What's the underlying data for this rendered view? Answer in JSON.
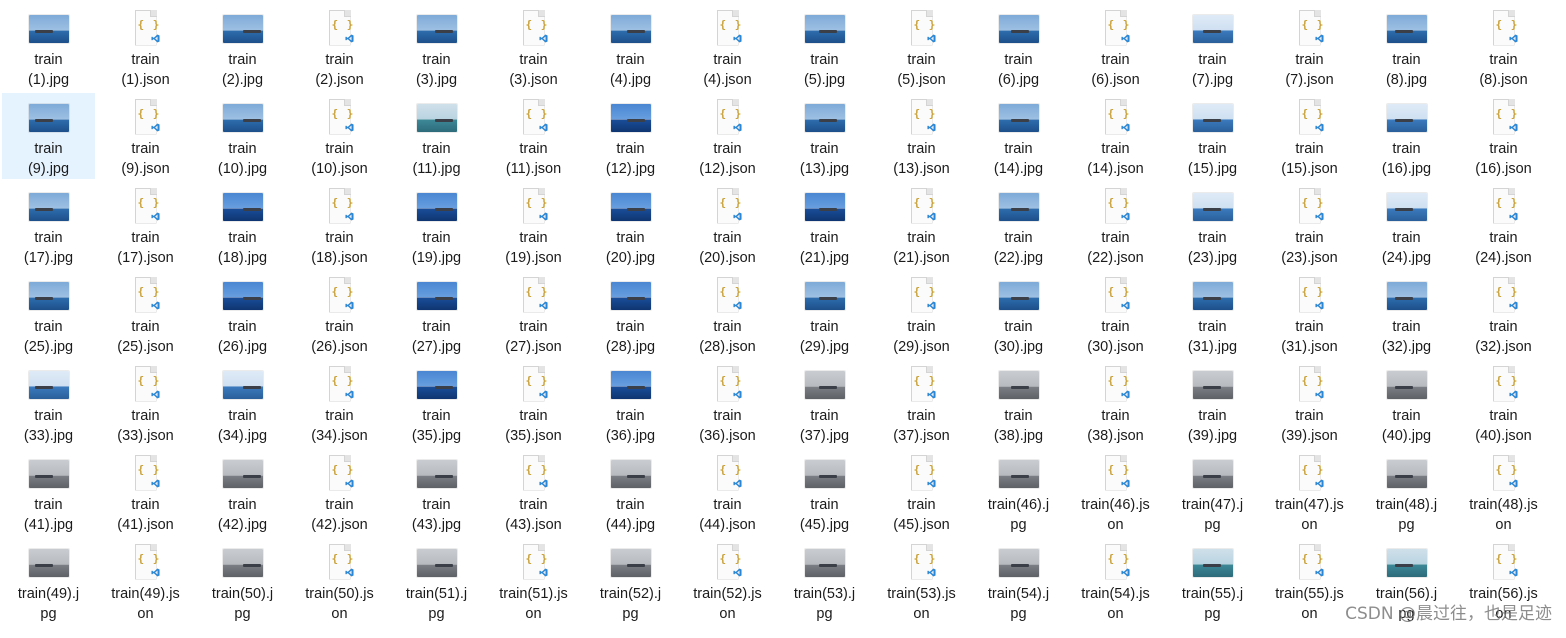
{
  "files": [
    {
      "label": "train\n(1).jpg",
      "kind": "jpg",
      "thumb": "blue"
    },
    {
      "label": "train\n(1).json",
      "kind": "json"
    },
    {
      "label": "train\n(2).jpg",
      "kind": "jpg",
      "thumb": "blue"
    },
    {
      "label": "train\n(2).json",
      "kind": "json"
    },
    {
      "label": "train\n(3).jpg",
      "kind": "jpg",
      "thumb": "blue"
    },
    {
      "label": "train\n(3).json",
      "kind": "json"
    },
    {
      "label": "train\n(4).jpg",
      "kind": "jpg",
      "thumb": "blue"
    },
    {
      "label": "train\n(4).json",
      "kind": "json"
    },
    {
      "label": "train\n(5).jpg",
      "kind": "jpg",
      "thumb": "blue"
    },
    {
      "label": "train\n(5).json",
      "kind": "json"
    },
    {
      "label": "train\n(6).jpg",
      "kind": "jpg",
      "thumb": "blue"
    },
    {
      "label": "train\n(6).json",
      "kind": "json"
    },
    {
      "label": "train\n(7).jpg",
      "kind": "jpg",
      "thumb": "cloud"
    },
    {
      "label": "train\n(7).json",
      "kind": "json"
    },
    {
      "label": "train\n(8).jpg",
      "kind": "jpg",
      "thumb": "blue"
    },
    {
      "label": "train\n(8).json",
      "kind": "json"
    },
    {
      "label": "train\n(9).jpg",
      "kind": "jpg",
      "thumb": "blue",
      "selected": true
    },
    {
      "label": "train\n(9).json",
      "kind": "json"
    },
    {
      "label": "train\n(10).jpg",
      "kind": "jpg",
      "thumb": "blue"
    },
    {
      "label": "train\n(10).json",
      "kind": "json"
    },
    {
      "label": "train\n(11).jpg",
      "kind": "jpg",
      "thumb": "teal"
    },
    {
      "label": "train\n(11).json",
      "kind": "json"
    },
    {
      "label": "train\n(12).jpg",
      "kind": "jpg",
      "thumb": "deep"
    },
    {
      "label": "train\n(12).json",
      "kind": "json"
    },
    {
      "label": "train\n(13).jpg",
      "kind": "jpg",
      "thumb": "blue"
    },
    {
      "label": "train\n(13).json",
      "kind": "json"
    },
    {
      "label": "train\n(14).jpg",
      "kind": "jpg",
      "thumb": "blue"
    },
    {
      "label": "train\n(14).json",
      "kind": "json"
    },
    {
      "label": "train\n(15).jpg",
      "kind": "jpg",
      "thumb": "cloud"
    },
    {
      "label": "train\n(15).json",
      "kind": "json"
    },
    {
      "label": "train\n(16).jpg",
      "kind": "jpg",
      "thumb": "cloud"
    },
    {
      "label": "train\n(16).json",
      "kind": "json"
    },
    {
      "label": "train\n(17).jpg",
      "kind": "jpg",
      "thumb": "blue"
    },
    {
      "label": "train\n(17).json",
      "kind": "json"
    },
    {
      "label": "train\n(18).jpg",
      "kind": "jpg",
      "thumb": "deep"
    },
    {
      "label": "train\n(18).json",
      "kind": "json"
    },
    {
      "label": "train\n(19).jpg",
      "kind": "jpg",
      "thumb": "deep"
    },
    {
      "label": "train\n(19).json",
      "kind": "json"
    },
    {
      "label": "train\n(20).jpg",
      "kind": "jpg",
      "thumb": "deep"
    },
    {
      "label": "train\n(20).json",
      "kind": "json"
    },
    {
      "label": "train\n(21).jpg",
      "kind": "jpg",
      "thumb": "deep"
    },
    {
      "label": "train\n(21).json",
      "kind": "json"
    },
    {
      "label": "train\n(22).jpg",
      "kind": "jpg",
      "thumb": "blue"
    },
    {
      "label": "train\n(22).json",
      "kind": "json"
    },
    {
      "label": "train\n(23).jpg",
      "kind": "jpg",
      "thumb": "cloud"
    },
    {
      "label": "train\n(23).json",
      "kind": "json"
    },
    {
      "label": "train\n(24).jpg",
      "kind": "jpg",
      "thumb": "cloud"
    },
    {
      "label": "train\n(24).json",
      "kind": "json"
    },
    {
      "label": "train\n(25).jpg",
      "kind": "jpg",
      "thumb": "blue"
    },
    {
      "label": "train\n(25).json",
      "kind": "json"
    },
    {
      "label": "train\n(26).jpg",
      "kind": "jpg",
      "thumb": "deep"
    },
    {
      "label": "train\n(26).json",
      "kind": "json"
    },
    {
      "label": "train\n(27).jpg",
      "kind": "jpg",
      "thumb": "deep"
    },
    {
      "label": "train\n(27).json",
      "kind": "json"
    },
    {
      "label": "train\n(28).jpg",
      "kind": "jpg",
      "thumb": "deep"
    },
    {
      "label": "train\n(28).json",
      "kind": "json"
    },
    {
      "label": "train\n(29).jpg",
      "kind": "jpg",
      "thumb": "blue"
    },
    {
      "label": "train\n(29).json",
      "kind": "json"
    },
    {
      "label": "train\n(30).jpg",
      "kind": "jpg",
      "thumb": "blue"
    },
    {
      "label": "train\n(30).json",
      "kind": "json"
    },
    {
      "label": "train\n(31).jpg",
      "kind": "jpg",
      "thumb": "blue"
    },
    {
      "label": "train\n(31).json",
      "kind": "json"
    },
    {
      "label": "train\n(32).jpg",
      "kind": "jpg",
      "thumb": "blue"
    },
    {
      "label": "train\n(32).json",
      "kind": "json"
    },
    {
      "label": "train\n(33).jpg",
      "kind": "jpg",
      "thumb": "cloud"
    },
    {
      "label": "train\n(33).json",
      "kind": "json"
    },
    {
      "label": "train\n(34).jpg",
      "kind": "jpg",
      "thumb": "cloud"
    },
    {
      "label": "train\n(34).json",
      "kind": "json"
    },
    {
      "label": "train\n(35).jpg",
      "kind": "jpg",
      "thumb": "deep"
    },
    {
      "label": "train\n(35).json",
      "kind": "json"
    },
    {
      "label": "train\n(36).jpg",
      "kind": "jpg",
      "thumb": "deep"
    },
    {
      "label": "train\n(36).json",
      "kind": "json"
    },
    {
      "label": "train\n(37).jpg",
      "kind": "jpg",
      "thumb": "grey"
    },
    {
      "label": "train\n(37).json",
      "kind": "json"
    },
    {
      "label": "train\n(38).jpg",
      "kind": "jpg",
      "thumb": "grey"
    },
    {
      "label": "train\n(38).json",
      "kind": "json"
    },
    {
      "label": "train\n(39).jpg",
      "kind": "jpg",
      "thumb": "grey"
    },
    {
      "label": "train\n(39).json",
      "kind": "json"
    },
    {
      "label": "train\n(40).jpg",
      "kind": "jpg",
      "thumb": "grey"
    },
    {
      "label": "train\n(40).json",
      "kind": "json"
    },
    {
      "label": "train\n(41).jpg",
      "kind": "jpg",
      "thumb": "grey"
    },
    {
      "label": "train\n(41).json",
      "kind": "json"
    },
    {
      "label": "train\n(42).jpg",
      "kind": "jpg",
      "thumb": "grey"
    },
    {
      "label": "train\n(42).json",
      "kind": "json"
    },
    {
      "label": "train\n(43).jpg",
      "kind": "jpg",
      "thumb": "grey"
    },
    {
      "label": "train\n(43).json",
      "kind": "json"
    },
    {
      "label": "train\n(44).jpg",
      "kind": "jpg",
      "thumb": "grey"
    },
    {
      "label": "train\n(44).json",
      "kind": "json"
    },
    {
      "label": "train\n(45).jpg",
      "kind": "jpg",
      "thumb": "grey"
    },
    {
      "label": "train\n(45).json",
      "kind": "json"
    },
    {
      "label": "train(46).j\npg",
      "kind": "jpg",
      "thumb": "grey"
    },
    {
      "label": "train(46).js\non",
      "kind": "json"
    },
    {
      "label": "train(47).j\npg",
      "kind": "jpg",
      "thumb": "grey"
    },
    {
      "label": "train(47).js\non",
      "kind": "json"
    },
    {
      "label": "train(48).j\npg",
      "kind": "jpg",
      "thumb": "grey"
    },
    {
      "label": "train(48).js\non",
      "kind": "json"
    },
    {
      "label": "train(49).j\npg",
      "kind": "jpg",
      "thumb": "grey"
    },
    {
      "label": "train(49).js\non",
      "kind": "json"
    },
    {
      "label": "train(50).j\npg",
      "kind": "jpg",
      "thumb": "grey"
    },
    {
      "label": "train(50).js\non",
      "kind": "json"
    },
    {
      "label": "train(51).j\npg",
      "kind": "jpg",
      "thumb": "grey"
    },
    {
      "label": "train(51).js\non",
      "kind": "json"
    },
    {
      "label": "train(52).j\npg",
      "kind": "jpg",
      "thumb": "grey"
    },
    {
      "label": "train(52).js\non",
      "kind": "json"
    },
    {
      "label": "train(53).j\npg",
      "kind": "jpg",
      "thumb": "grey"
    },
    {
      "label": "train(53).js\non",
      "kind": "json"
    },
    {
      "label": "train(54).j\npg",
      "kind": "jpg",
      "thumb": "grey"
    },
    {
      "label": "train(54).js\non",
      "kind": "json"
    },
    {
      "label": "train(55).j\npg",
      "kind": "jpg",
      "thumb": "teal"
    },
    {
      "label": "train(55).js\non",
      "kind": "json"
    },
    {
      "label": "train(56).j\npg",
      "kind": "jpg",
      "thumb": "teal"
    },
    {
      "label": "train(56).js\non",
      "kind": "json"
    }
  ],
  "json_icon": {
    "braces": "{ }",
    "icon": "json-file-icon"
  },
  "watermark": "CSDN @晨过往，也是足迹",
  "colors": {
    "selection": "#e5f3ff",
    "text": "#1b1b1b",
    "json_braces": "#c9a23a",
    "vscode_badge": "#2b87d6"
  }
}
